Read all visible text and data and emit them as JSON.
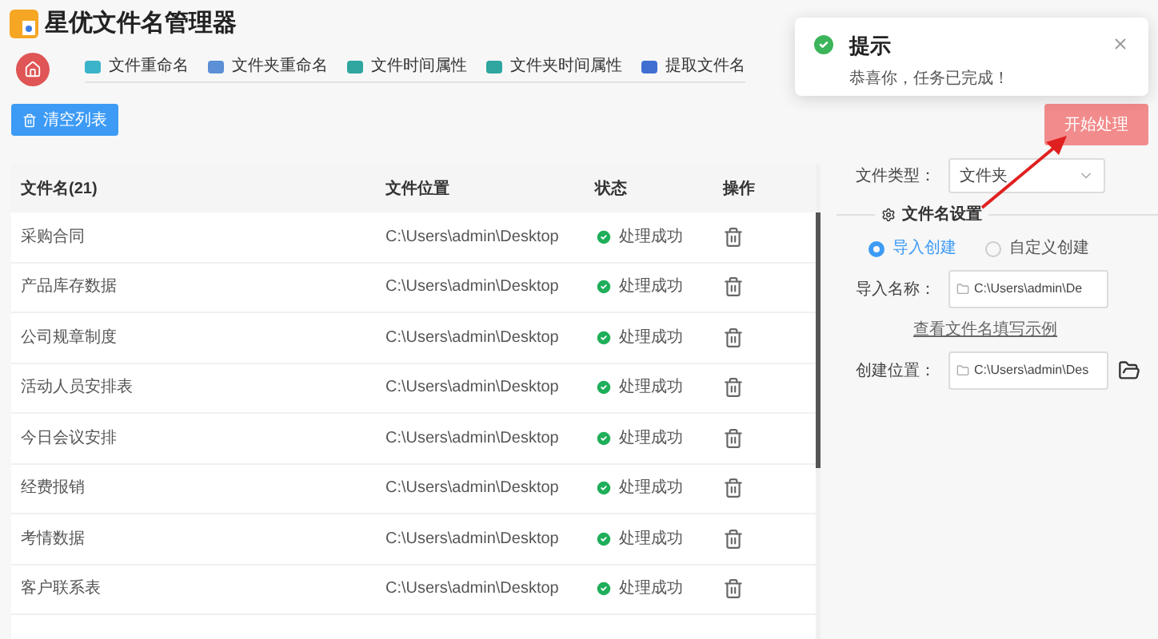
{
  "window": {
    "title": "星优文件名管理器"
  },
  "toolbar": {
    "tabs": [
      {
        "label": "文件重命名",
        "color": "#3bb3c9"
      },
      {
        "label": "文件夹重命名",
        "color": "#5b8fd6"
      },
      {
        "label": "文件时间属性",
        "color": "#2fa6a0"
      },
      {
        "label": "文件夹时间属性",
        "color": "#2fa6a0"
      },
      {
        "label": "提取文件名",
        "color": "#3f6fd1"
      }
    ]
  },
  "clear_button": "清空列表",
  "start_button": "开始处理",
  "notification": {
    "title": "提示",
    "message": "恭喜你，任务已完成！"
  },
  "table": {
    "columns": [
      "文件名(21)",
      "文件位置",
      "状态",
      "操作"
    ],
    "rows": [
      {
        "name": "采购合同",
        "location": "C:\\Users\\admin\\Desktop",
        "status": "处理成功"
      },
      {
        "name": "产品库存数据",
        "location": "C:\\Users\\admin\\Desktop",
        "status": "处理成功"
      },
      {
        "name": "公司规章制度",
        "location": "C:\\Users\\admin\\Desktop",
        "status": "处理成功"
      },
      {
        "name": "活动人员安排表",
        "location": "C:\\Users\\admin\\Desktop",
        "status": "处理成功"
      },
      {
        "name": "今日会议安排",
        "location": "C:\\Users\\admin\\Desktop",
        "status": "处理成功"
      },
      {
        "name": "经费报销",
        "location": "C:\\Users\\admin\\Desktop",
        "status": "处理成功"
      },
      {
        "name": "考情数据",
        "location": "C:\\Users\\admin\\Desktop",
        "status": "处理成功"
      },
      {
        "name": "客户联系表",
        "location": "C:\\Users\\admin\\Desktop",
        "status": "处理成功"
      }
    ]
  },
  "settings": {
    "file_type_label": "文件类型：",
    "file_type_value": "文件夹",
    "section_title": "文件名设置",
    "modes": [
      {
        "label": "导入创建",
        "selected": true
      },
      {
        "label": "自定义创建",
        "selected": false
      }
    ],
    "import_label": "导入名称：",
    "import_value": "C:\\Users\\admin\\De",
    "example_link": "查看文件名填写示例",
    "location_label": "创建位置：",
    "location_value": "C:\\Users\\admin\\Des"
  }
}
